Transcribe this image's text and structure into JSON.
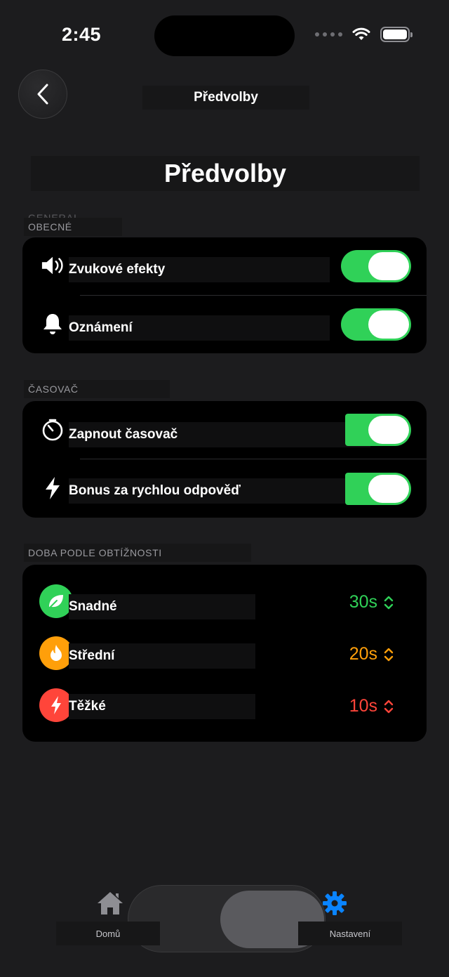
{
  "status_bar": {
    "time": "2:45"
  },
  "nav": {
    "title": "Předvolby"
  },
  "page": {
    "title": "Předvolby"
  },
  "sections": {
    "general": {
      "header_faint": "GENERAL",
      "header": "OBECNÉ",
      "rows": [
        {
          "label": "Zvukové efekty",
          "icon": "speaker-icon",
          "enabled": true
        },
        {
          "label": "Oznámení",
          "icon": "bell-icon",
          "enabled": true
        }
      ]
    },
    "timer": {
      "header": "ČASOVAČ",
      "rows": [
        {
          "label": "Zapnout časovač",
          "icon": "timer-icon",
          "enabled": true
        },
        {
          "label": "Bonus za rychlou odpověď",
          "icon": "bolt-icon",
          "enabled": true
        }
      ]
    },
    "difficulty": {
      "header": "DOBA PODLE OBTÍŽNOSTI",
      "rows": [
        {
          "label": "Snadné",
          "value": "30s",
          "color": "#30d158",
          "icon": "leaf-icon"
        },
        {
          "label": "Střední",
          "value": "20s",
          "color": "#ff9f0a",
          "icon": "flame-icon"
        },
        {
          "label": "Těžké",
          "value": "10s",
          "color": "#ff453a",
          "icon": "bolt-icon"
        }
      ]
    }
  },
  "tab_bar": {
    "tabs": [
      {
        "label": "Domů",
        "icon": "house-icon",
        "selected": false
      },
      {
        "label": "Nastavení",
        "icon": "gear-icon",
        "selected": true
      }
    ]
  },
  "colors": {
    "accent": "#0a84ff",
    "toggle_on": "#30d158"
  }
}
